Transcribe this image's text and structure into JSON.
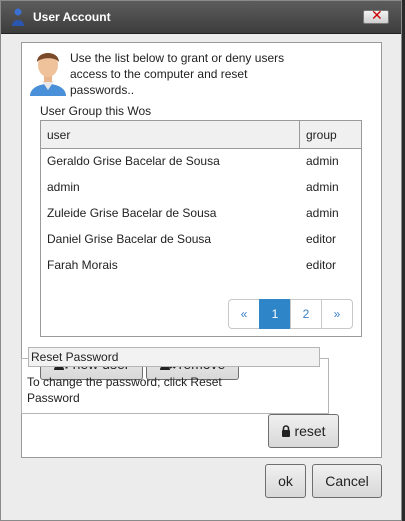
{
  "window": {
    "title": "User Account",
    "close_glyph": "✕"
  },
  "intro": {
    "text": "Use the list below to grant or deny users access to the computer and reset passwords.."
  },
  "group_label": "User Group this Wos",
  "table": {
    "columns": [
      "user",
      "group"
    ],
    "rows": [
      {
        "user": "Geraldo Grise Bacelar de Sousa",
        "group": "admin"
      },
      {
        "user": "admin",
        "group": "admin"
      },
      {
        "user": "Zuleide Grise Bacelar de Sousa",
        "group": "admin"
      },
      {
        "user": "Daniel Grise Bacelar de Sousa",
        "group": "editor"
      },
      {
        "user": "Farah Morais",
        "group": "editor"
      }
    ]
  },
  "pagination": {
    "prev": "«",
    "pages": [
      "1",
      "2"
    ],
    "next": "»",
    "current": "1"
  },
  "actions": {
    "new_user": "new user",
    "remove": "remove"
  },
  "reset_password": {
    "legend": "Reset Password",
    "text": "To change the password; click Reset Password",
    "button": "reset"
  },
  "footer": {
    "ok": "ok",
    "cancel": "Cancel"
  },
  "colors": {
    "accent": "#2e86c9",
    "titlebar": "#4a4a4a",
    "close": "#cc0000"
  },
  "icons": {
    "title": "user-icon",
    "avatar": "user-avatar-icon",
    "new_user": "user-add-icon",
    "remove": "user-remove-icon",
    "reset": "lock-icon"
  }
}
